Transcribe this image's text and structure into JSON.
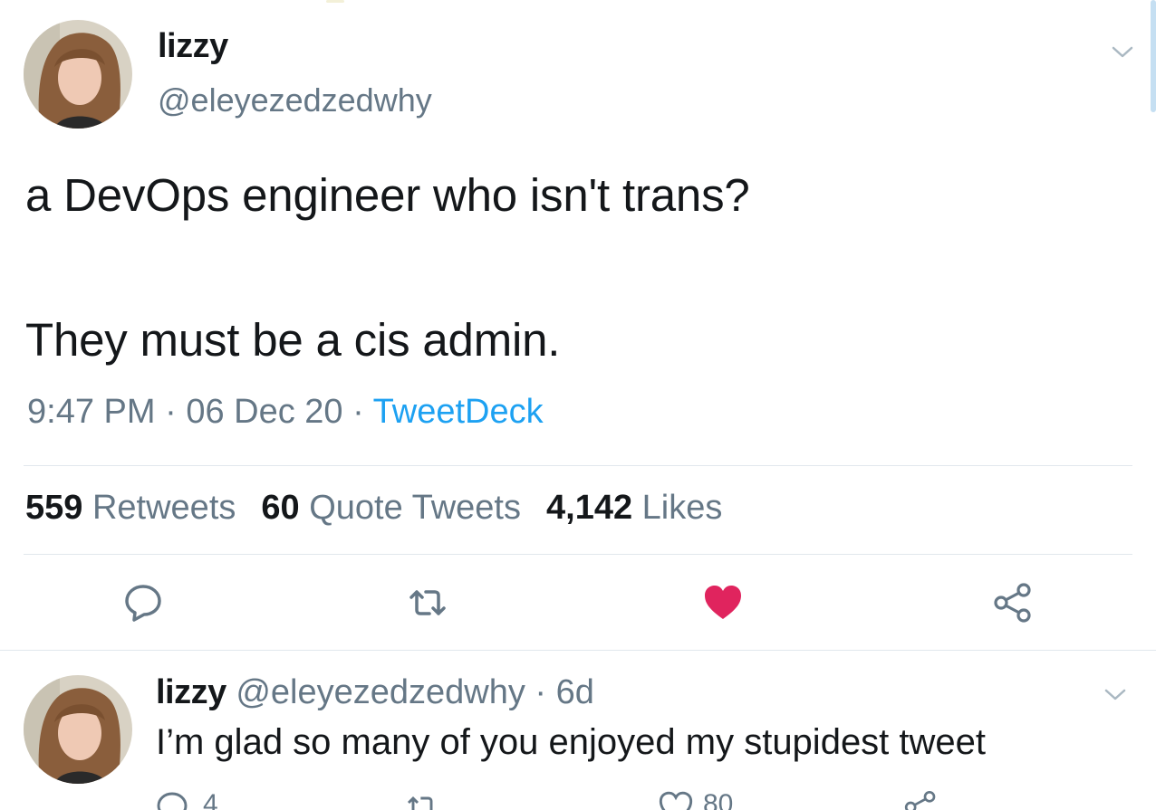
{
  "main_tweet": {
    "display_name": "lizzy",
    "handle": "@eleyezedzedwhy",
    "text_line1": "a DevOps engineer who isn't trans?",
    "text_line2": "They must be a cis admin.",
    "time": "9:47 PM",
    "sep1": " · ",
    "date": "06 Dec 20",
    "sep2": " · ",
    "source": "TweetDeck",
    "retweets_count": "559",
    "retweets_label": "Retweets",
    "quotes_count": "60",
    "quotes_label": "Quote Tweets",
    "likes_count": "4,142",
    "likes_label": "Likes",
    "liked": true
  },
  "reply_tweet": {
    "display_name": "lizzy",
    "handle": "@eleyezedzedwhy",
    "sep": " · ",
    "age": "6d",
    "text": "I’m glad so many of you enjoyed my stupidest tweet",
    "reply_count": "4",
    "like_count": "80"
  },
  "icons": {
    "reply": "reply-icon",
    "retweet": "retweet-icon",
    "like": "heart-icon",
    "share": "share-icon",
    "caret": "chevron-down-icon"
  },
  "colors": {
    "text": "#14171a",
    "secondary": "#657786",
    "link": "#1da1f2",
    "like": "#e0245e",
    "divider": "#e1e8ed"
  }
}
